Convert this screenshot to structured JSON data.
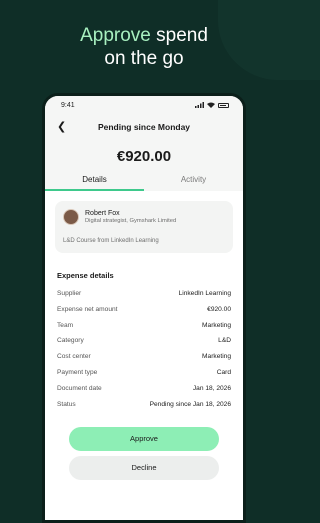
{
  "headline": {
    "accent": "Approve",
    "rest_line1": " spend",
    "line2": "on the go"
  },
  "status": {
    "time": "9:41"
  },
  "header": {
    "title": "Pending since Monday",
    "amount": "€920.00"
  },
  "tabs": [
    {
      "label": "Details"
    },
    {
      "label": "Activity"
    }
  ],
  "card": {
    "name": "Robert Fox",
    "role": "Digital strategist, Gymshark Limited",
    "note": "L&D Course from LinkedIn Learning"
  },
  "details": {
    "title": "Expense details",
    "rows": [
      {
        "label": "Supplier",
        "value": "LinkedIn Learning"
      },
      {
        "label": "Expense net amount",
        "value": "€920.00"
      },
      {
        "label": "Team",
        "value": "Marketing"
      },
      {
        "label": "Category",
        "value": "L&D"
      },
      {
        "label": "Cost center",
        "value": "Marketing"
      },
      {
        "label": "Payment type",
        "value": "Card"
      },
      {
        "label": "Document date",
        "value": "Jan 18, 2026"
      },
      {
        "label": "Status",
        "value": "Pending since Jan 18, 2026"
      }
    ]
  },
  "actions": {
    "approve": "Approve",
    "decline": "Decline"
  },
  "colors": {
    "background": "#0f2e27",
    "accent": "#a8f0c0",
    "approve": "#8deeb5",
    "tab_underline": "#3ec98c"
  }
}
